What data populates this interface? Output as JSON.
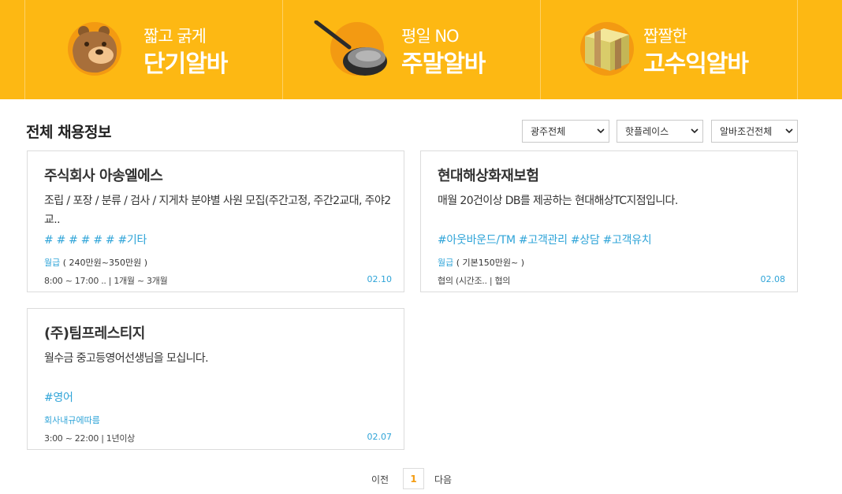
{
  "banner": {
    "items": [
      {
        "subtitle": "짧고 굵게",
        "title": "단기알바",
        "icon": "bear-icon"
      },
      {
        "subtitle": "평일 NO",
        "title": "주말알바",
        "icon": "frying-pan-icon"
      },
      {
        "subtitle": "짭짤한",
        "title": "고수익알바",
        "icon": "gift-box-icon"
      }
    ],
    "color": "#fdb813"
  },
  "section": {
    "title": "전체 채용정보"
  },
  "filters": [
    {
      "selected": "광주전체"
    },
    {
      "selected": "핫플레이스"
    },
    {
      "selected": "알바조건전체"
    }
  ],
  "cards": [
    {
      "company": "주식회사 아송엘에스",
      "description": "조립 / 포장 / 분류 / 검사 / 지게차 분야별 사원 모집(주간고정, 주간2교대, 주야2교..",
      "tags": "# # # # # # #기타",
      "pay_type": "월급",
      "pay_range": "( 240만원~350만원 )",
      "meta": "8:00 ~ 17:00 .. | 1개월 ~ 3개월",
      "date": "02.10"
    },
    {
      "company": "현대해상화재보험",
      "description": "매월 20건이상 DB를 제공하는 현대해상TC지점입니다.",
      "tags": "#아웃바운드/TM #고객관리 #상담 #고객유치",
      "pay_type": "월급",
      "pay_range": "( 기본150만원~ )",
      "meta": "협의 (시간조.. | 협의",
      "date": "02.08"
    },
    {
      "company": "(주)팀프레스티지",
      "description": "월수금 중고등영어선생님을 모십니다.",
      "tags": "#영어",
      "pay_type": "회사내규에따름",
      "pay_range": "",
      "meta": "3:00 ~ 22:00 | 1년이상",
      "date": "02.07"
    }
  ],
  "pagination": {
    "prev": "이전",
    "current": "1",
    "next": "다음"
  },
  "colors": {
    "accent": "#fdb813",
    "link": "#2fa4d8",
    "page_current": "#f39c12"
  }
}
